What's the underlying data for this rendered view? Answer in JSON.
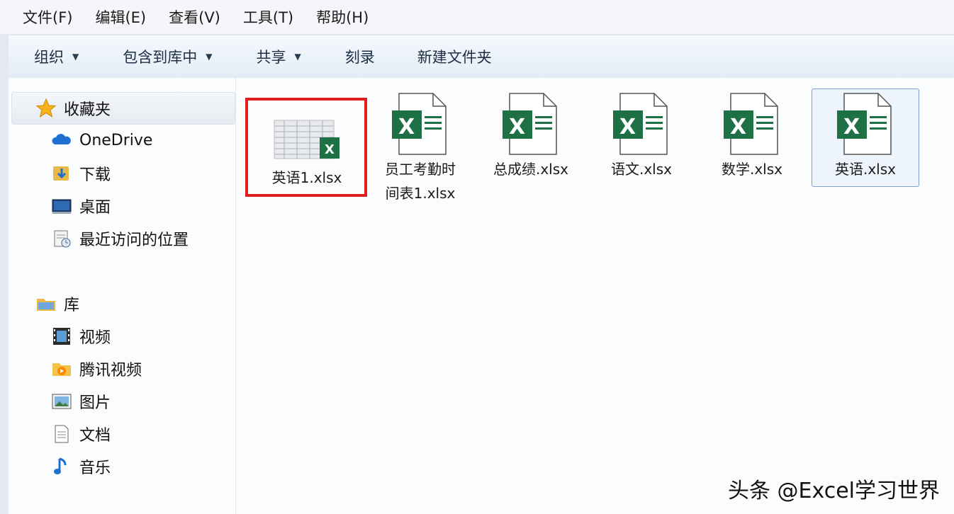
{
  "menu": [
    "文件(F)",
    "编辑(E)",
    "查看(V)",
    "工具(T)",
    "帮助(H)"
  ],
  "toolbar": {
    "organize": "组织",
    "include_library": "包含到库中",
    "share": "共享",
    "burn": "刻录",
    "new_folder": "新建文件夹"
  },
  "nav": {
    "favorites": "收藏夹",
    "onedrive": "OneDrive",
    "downloads": "下载",
    "desktop": "桌面",
    "recent": "最近访问的位置",
    "libraries": "库",
    "videos": "视频",
    "tencent_video": "腾讯视频",
    "pictures": "图片",
    "documents": "文档",
    "music": "音乐"
  },
  "files": [
    {
      "line1": "英语1.xlsx",
      "line2": ""
    },
    {
      "line1": "员工考勤时",
      "line2": "间表1.xlsx"
    },
    {
      "line1": "总成绩.xlsx",
      "line2": ""
    },
    {
      "line1": "语文.xlsx",
      "line2": ""
    },
    {
      "line1": "数学.xlsx",
      "line2": ""
    },
    {
      "line1": "英语.xlsx",
      "line2": ""
    }
  ],
  "excel_glyph": "X",
  "watermark": "头条 @Excel学习世界",
  "colors": {
    "excel_green": "#1e7145",
    "highlight_red": "#e02020",
    "selection_border": "#7da2ce"
  }
}
